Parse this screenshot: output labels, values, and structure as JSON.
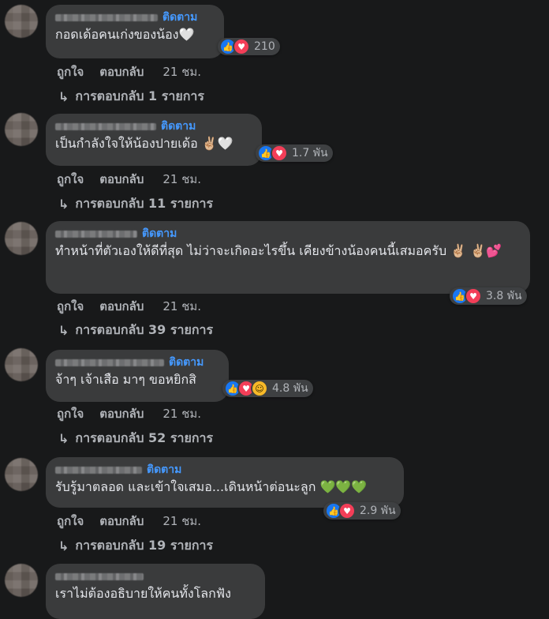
{
  "follow_label": "ติดตาม",
  "action_like": "ถูกใจ",
  "action_reply": "ตอบกลับ",
  "comments": [
    {
      "text": "กอดเด้อคนเก่งของน้อง🤍",
      "reactions": [
        "like-icon",
        "love-icon"
      ],
      "count": "210",
      "time": "21 ชม.",
      "replies": "การตอบกลับ 1 รายการ"
    },
    {
      "text": "เป็นกำลังใจให้น้องปายเด้อ ✌🏼🤍",
      "reactions": [
        "like-icon",
        "love-icon"
      ],
      "count": "1.7 พัน",
      "time": "21 ชม.",
      "replies": "การตอบกลับ 11 รายการ"
    },
    {
      "text": "ทำหน้าที่ตัวเองให้ดีที่สุด ไม่ว่าจะเกิดอะไรขึ้น เคียงข้างน้องคนนี้เสมอครับ ✌🏼 ✌🏼💕",
      "reactions": [
        "like-icon",
        "love-icon"
      ],
      "count": "3.8 พัน",
      "time": "21 ชม.",
      "replies": "การตอบกลับ 39 รายการ"
    },
    {
      "text": "จ้าๆ เจ้าเสือ มาๆ ขอหยิกสิ",
      "reactions": [
        "like-icon",
        "love-icon",
        "haha-icon"
      ],
      "count": "4.8 พัน",
      "time": "21 ชม.",
      "replies": "การตอบกลับ 52 รายการ"
    },
    {
      "text": "รับรู้มาตลอด และเข้าใจเสมอ...เดินหน้าต่อนะลูก 💚💚💚",
      "reactions": [
        "like-icon",
        "love-icon"
      ],
      "count": "2.9 พัน",
      "time": "21 ชม.",
      "replies": "การตอบกลับ 19 รายการ"
    },
    {
      "text": "เราไม่ต้องอธิบายให้คนทั้งโลกฟัง"
    }
  ]
}
